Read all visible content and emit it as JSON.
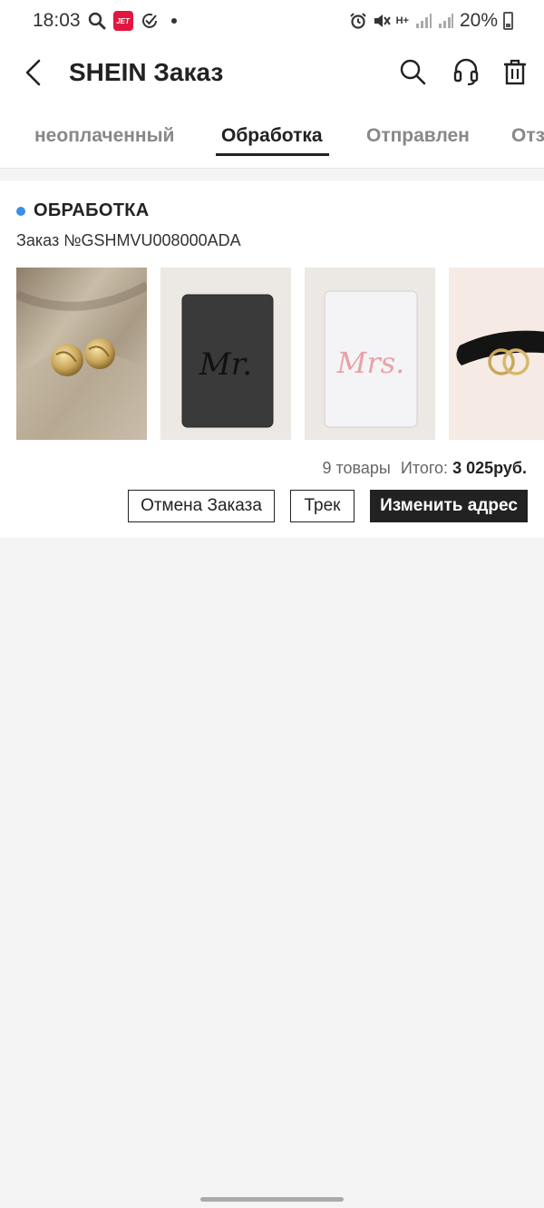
{
  "status_bar": {
    "time": "18:03",
    "jet_label": "JET",
    "battery": "20%",
    "network_label": "H+",
    "icons": [
      "search-icon",
      "jet-app-icon",
      "check-circle-icon",
      "notification-dot",
      "alarm-icon",
      "mute-icon",
      "network-icon",
      "signal-icon",
      "battery-icon"
    ]
  },
  "header": {
    "title": "SHEIN Заказ",
    "icons": [
      "back-icon",
      "search-icon",
      "headset-icon",
      "trash-icon"
    ]
  },
  "tabs": {
    "items": [
      {
        "label": "неоплаченный"
      },
      {
        "label": "Обработка"
      },
      {
        "label": "Отправлен"
      },
      {
        "label": "Отз"
      }
    ],
    "active_index": 1
  },
  "order": {
    "status": "ОБРАБОТКА",
    "status_color": "#3b8fe8",
    "number": "Заказ №GSHMVU008000ADA",
    "products": [
      {
        "name": "gold-knot-earrings"
      },
      {
        "name": "mr-passport-cover",
        "label": "Mr."
      },
      {
        "name": "mrs-passport-cover",
        "label": "Mrs."
      },
      {
        "name": "black-belt-gold-buckle"
      }
    ],
    "items_count": "9 товары",
    "total_label": "Итого:",
    "total_value": "3 025руб.",
    "buttons": {
      "cancel": "Отмена Заказа",
      "track": "Трек",
      "change_address": "Изменить адрес"
    }
  },
  "colors": {
    "accent": "#222222",
    "background": "#f4f4f4",
    "status_dot": "#3b8fe8"
  }
}
